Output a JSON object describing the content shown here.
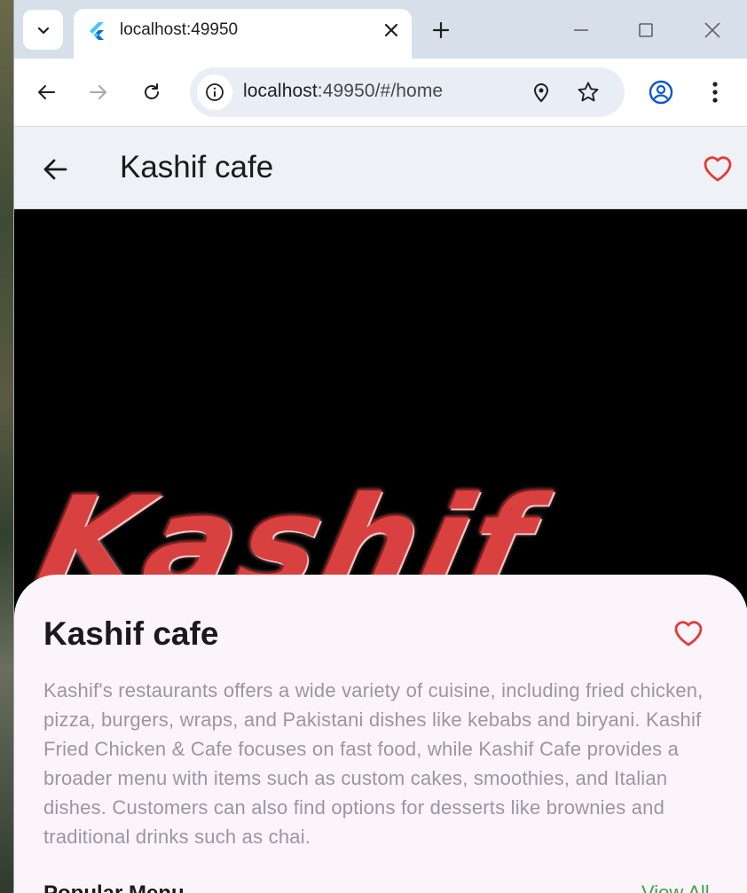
{
  "browser": {
    "tab_title": "localhost:49950",
    "url_host": "localhost",
    "url_rest": ":49950/#/home"
  },
  "app": {
    "appbar_title": "Kashif cafe",
    "hero_logo_text": "Kashif",
    "restaurant_name": "Kashif cafe",
    "description": "Kashif's restaurants  offers a wide variety of cuisine, including fried chicken, pizza, burgers, wraps, and Pakistani dishes like kebabs and biryani. Kashif Fried Chicken & Cafe focuses on fast food, while Kashif Cafe provides a broader menu with items such as custom cakes, smoothies, and Italian dishes. Customers can also find options for desserts like brownies and traditional drinks such as chai.",
    "popular_menu_label": "Popular Menu",
    "view_all_label": "View All"
  },
  "icons": {
    "favorite": "heart-outline-icon",
    "back": "arrow-left-icon"
  },
  "colors": {
    "heart": "#e53935",
    "view_all": "#3aa64a",
    "appbar_bg": "#f0f1f6",
    "sheet_bg": "#fcf4fb"
  }
}
